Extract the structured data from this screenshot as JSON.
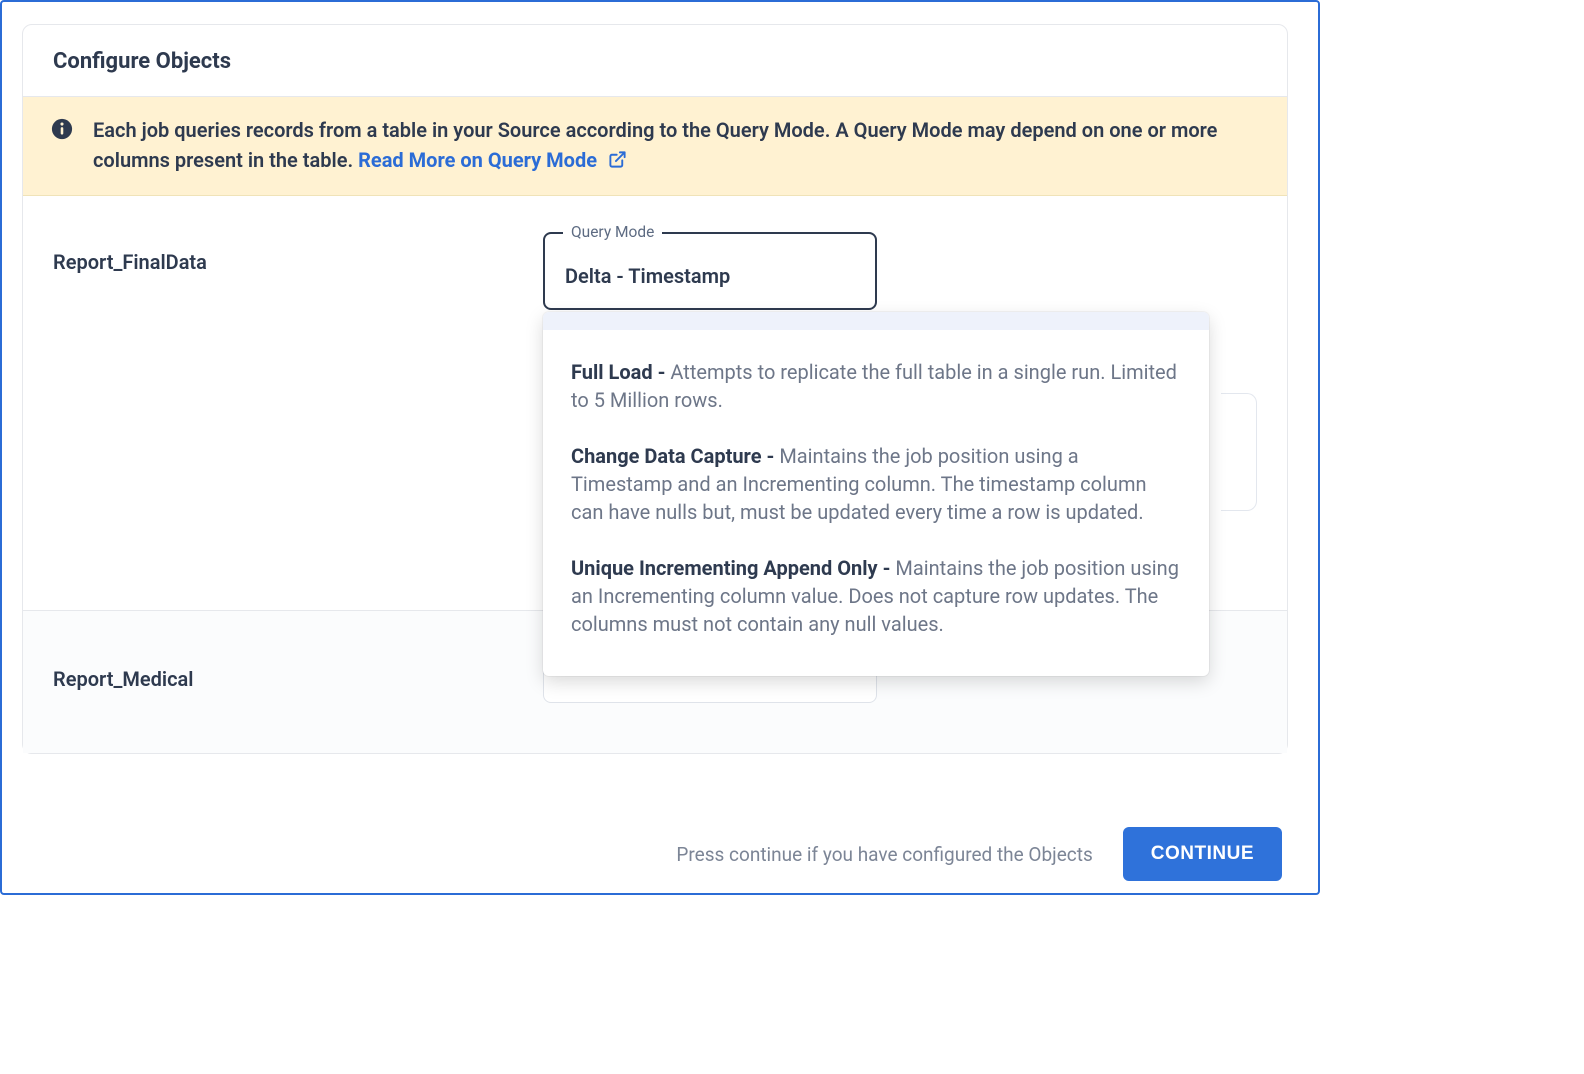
{
  "header": {
    "title": "Configure Objects"
  },
  "banner": {
    "text_before_link": "Each job queries records from a table in your Source according to the Query Mode. A Query Mode may depend on one or more columns present in the table. ",
    "link_text": "Read More on Query Mode"
  },
  "rows": [
    {
      "label": "Report_FinalData",
      "field_legend": "Query Mode",
      "field_value": "Delta - Timestamp"
    },
    {
      "label": "Report_Medical"
    }
  ],
  "dropdown": {
    "options": [
      {
        "title": "Full Load",
        "desc": "Attempts to replicate the full table in a single run. Limited to 5 Million rows."
      },
      {
        "title": "Change Data Capture",
        "desc": "Maintains the job position using a Timestamp and an Incrementing column. The timestamp column can have nulls but, must be updated every time a row is updated."
      },
      {
        "title": "Unique Incrementing Append Only",
        "desc": "Maintains the job position using an Incrementing column value. Does not capture row updates. The columns must not contain any null values."
      }
    ]
  },
  "footer": {
    "hint": "Press continue if you have configured the Objects",
    "button": "CONTINUE"
  }
}
